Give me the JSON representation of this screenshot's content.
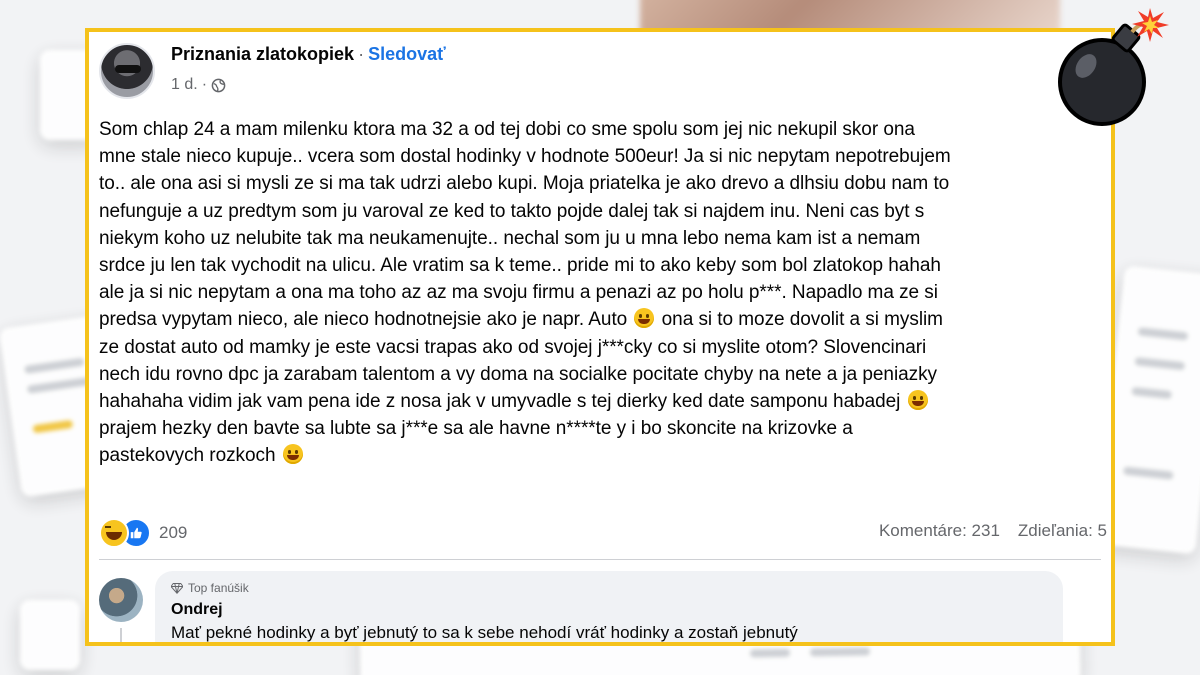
{
  "post": {
    "page_name": "Priznania zlatokopiek",
    "separator": "·",
    "follow_label": "Sledovať",
    "time": "1 d.",
    "meta_dot": "·",
    "body_segments": [
      "Som chlap 24 a mam milenku ktora ma 32 a od tej dobi co sme spolu som jej nic nekupil skor ona\nmne stale nieco kupuje.. vcera som dostal hodinky v hodnote 500eur! Ja si nic nepytam nepotrebujem\nto.. ale ona asi si mysli ze si ma tak udrzi alebo kupi. Moja priatelka je ako drevo a dlhsiu dobu nam to\nnefunguje a uz predtym som ju varoval ze ked to takto pojde dalej tak si najdem inu. Neni cas byt s\nniekym koho uz nelubite tak ma neukamenujte.. nechal som ju u mna lebo nema kam ist a nemam\nsrdce ju len tak vychodit na ulicu. Ale vratim sa k teme.. pride mi to ako keby som bol zlatokop hahah\nale ja si nic nepytam a ona ma toho az az ma svoju firmu a penazi az po holu p***. Napadlo ma ze si\npredsa vypytam nieco, ale nieco hodnotnejsie ako je napr. Auto",
      " ona si to moze dovolit a si myslim\nze dostat auto od mamky je este vacsi trapas ako od svojej j***cky co si myslite otom? Slovencinari\nnech idu rovno dpc ja zarabam talentom a vy doma na socialke pocitate chyby na nete a ja peniazky\nhahahaha vidim jak vam pena ide z nosa jak v umyvadle s tej dierky ked date samponu habadej",
      "\nprajem hezky den bavte sa lubte sa j***e sa ale havne n****te y i bo skoncite na krizovke a\npastekovych rozkoch"
    ],
    "reaction_count": "209",
    "comments_label": "Komentáre: 231",
    "shares_label": "Zdieľania: 5"
  },
  "comment": {
    "badge": "Top fanúšik",
    "author": "Ondrej",
    "text": "Mať pekné hodinky a byť jebnutý to sa k sebe nehodí vráť hodinky a zostaň jebnutý"
  },
  "colors": {
    "frame": "#f5c21b",
    "link": "#1b74e4",
    "secondary_text": "#65676b"
  },
  "icons": [
    "globe-icon",
    "haha-reaction-icon",
    "like-reaction-icon",
    "diamond-icon",
    "bomb-icon",
    "smiley-emoji"
  ]
}
